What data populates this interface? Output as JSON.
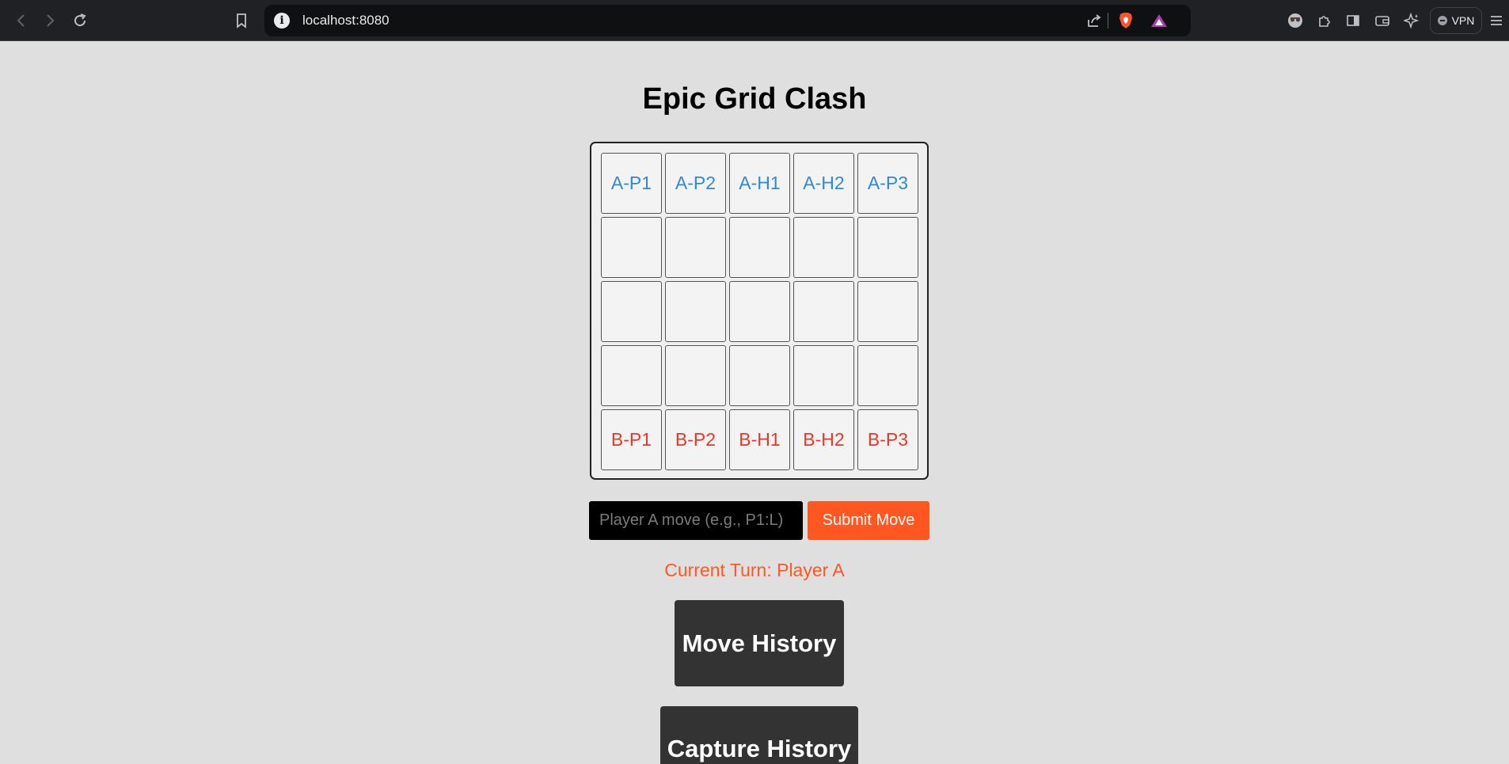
{
  "browser": {
    "url": "localhost:8080",
    "vpn_label": "VPN",
    "icons": [
      "back-icon",
      "forward-icon",
      "reload-icon",
      "bookmark-icon",
      "site-info-icon",
      "share-icon",
      "brave-shields-icon",
      "brave-rewards-icon",
      "profile-icon",
      "extensions-icon",
      "sidebar-icon",
      "wallet-icon",
      "leo-ai-icon",
      "vpn-icon",
      "menu-icon"
    ]
  },
  "page": {
    "title": "Epic Grid Clash",
    "board": [
      [
        "A-P1",
        "A-P2",
        "A-H1",
        "A-H2",
        "A-P3"
      ],
      [
        "",
        "",
        "",
        "",
        ""
      ],
      [
        "",
        "",
        "",
        "",
        ""
      ],
      [
        "",
        "",
        "",
        "",
        ""
      ],
      [
        "B-P1",
        "B-P2",
        "B-H1",
        "B-H2",
        "B-P3"
      ]
    ],
    "move_input_placeholder": "Player A move (e.g., P1:L)",
    "submit_label": "Submit Move",
    "turn_text": "Current Turn: Player A",
    "move_history_label": "Move History",
    "capture_history_label": "Capture History"
  },
  "colors": {
    "player_a": "#2f8ad6",
    "player_b": "#e23a2a",
    "accent": "#ff5722",
    "panel": "#333333",
    "background": "#dfdfdf"
  }
}
